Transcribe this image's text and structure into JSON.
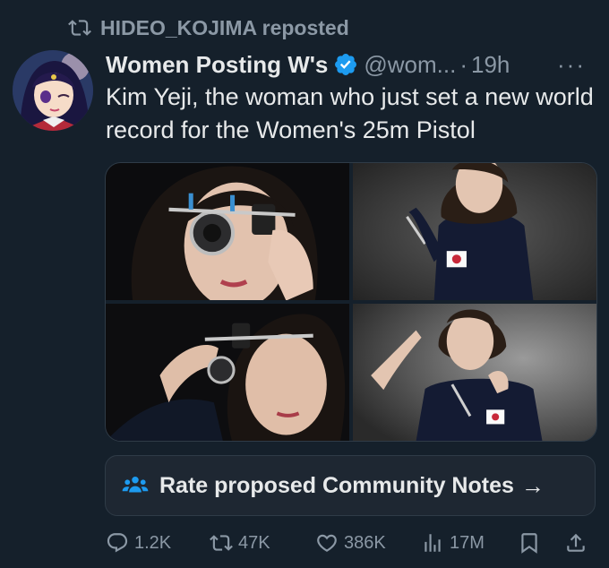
{
  "repost": {
    "icon": "repost-icon",
    "text": "HIDEO_KOJIMA reposted"
  },
  "author": {
    "display_name": "Women Posting W's",
    "verified_icon": "verified-badge-icon",
    "handle": "@wom...",
    "separator": "·",
    "time": "19h",
    "more_icon": "more-dots-icon"
  },
  "tweet": {
    "text": "Kim Yeji, the woman who just set a new world record for the Women's 25m Pistol"
  },
  "media": {
    "count": 4,
    "photos": [
      "photo-shooting-glasses-closeup",
      "photo-standing-jersey",
      "photo-adjusting-glasses",
      "photo-finger-gun-pose"
    ]
  },
  "community_notes": {
    "icon": "people-icon",
    "label": "Rate proposed Community Notes",
    "arrow": "→"
  },
  "actions": {
    "replies": "1.2K",
    "reposts": "47K",
    "likes": "386K",
    "views": "17M"
  },
  "colors": {
    "background": "#15202b",
    "text_primary": "#e7e9ea",
    "text_secondary": "#8b98a5",
    "accent": "#1d9bf0",
    "border": "#2f3b47"
  }
}
